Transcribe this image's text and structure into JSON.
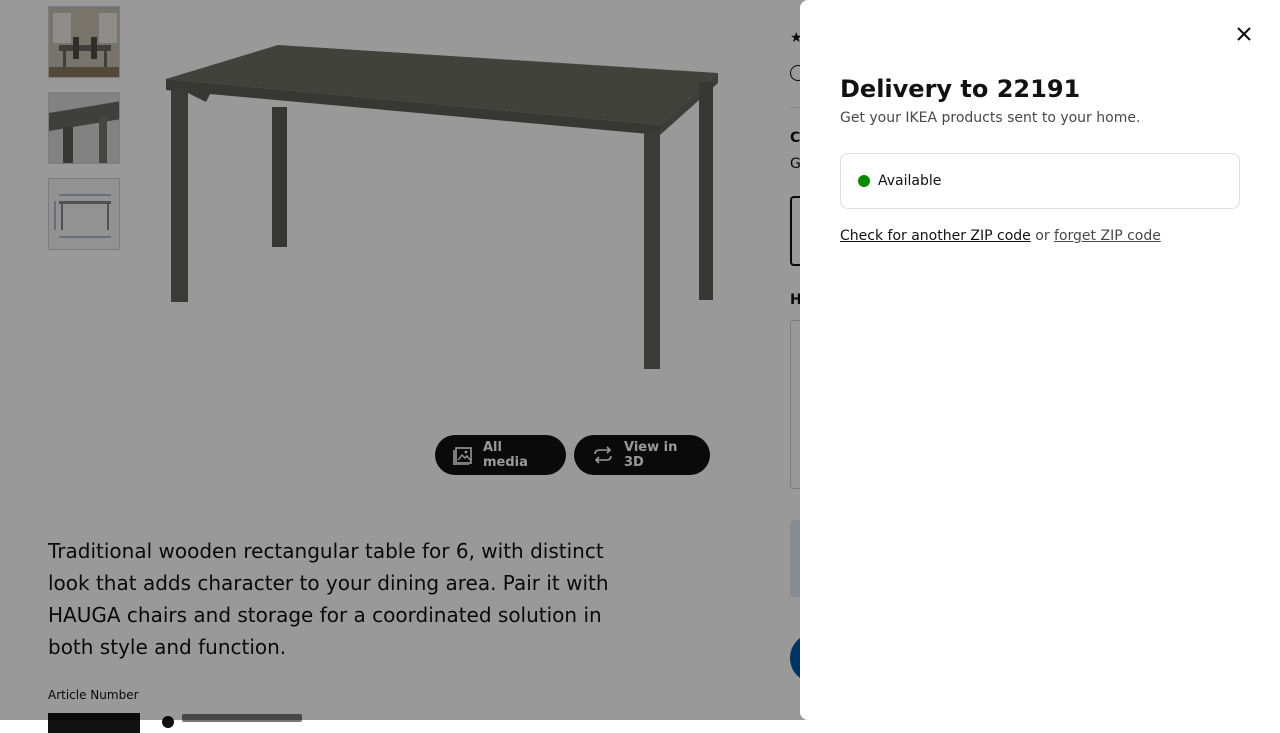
{
  "background_page": {
    "media_buttons": {
      "all_media_label": "All media",
      "view_3d_label": "View in 3D"
    },
    "description": "Traditional wooden rectangular table for 6, with distinct look that adds character to your dining area. Pair it with HAUGA chairs and storage for a coordinated solution in both style and function.",
    "article_number_label": "Article Number",
    "right_column": {
      "c_heading_fragment": "C",
      "g_text_fragment": "G",
      "h_heading_fragment": "H"
    }
  },
  "delivery_modal": {
    "title": "Delivery to 22191",
    "subtitle": "Get your IKEA products sent to your home.",
    "availability": {
      "status": "Available",
      "status_color": "#0a8a00"
    },
    "check_link": "Check for another ZIP code",
    "or_text": "or",
    "forget_link": "forget ZIP code"
  }
}
